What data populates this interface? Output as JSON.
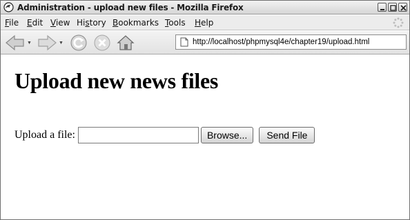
{
  "window": {
    "title": "Administration - upload new files - Mozilla Firefox"
  },
  "menu": {
    "items": [
      {
        "label": "File",
        "mnemonic": "F",
        "rest": "ile"
      },
      {
        "label": "Edit",
        "mnemonic": "E",
        "rest": "dit"
      },
      {
        "label": "View",
        "mnemonic": "V",
        "rest": "iew"
      },
      {
        "label": "History",
        "mnemonic": "s",
        "pre": "Hi",
        "rest": "tory"
      },
      {
        "label": "Bookmarks",
        "mnemonic": "B",
        "rest": "ookmarks"
      },
      {
        "label": "Tools",
        "mnemonic": "T",
        "rest": "ools"
      },
      {
        "label": "Help",
        "mnemonic": "H",
        "rest": "elp"
      }
    ]
  },
  "toolbar": {
    "url": "http://localhost/phpmysql4e/chapter19/upload.html",
    "icons": [
      "back-icon",
      "forward-icon",
      "reload-icon",
      "stop-icon",
      "home-icon",
      "page-icon"
    ]
  },
  "page": {
    "heading": "Upload new news files",
    "file_label": "Upload a file:",
    "file_value": "",
    "browse_label": "Browse...",
    "send_label": "Send File"
  }
}
